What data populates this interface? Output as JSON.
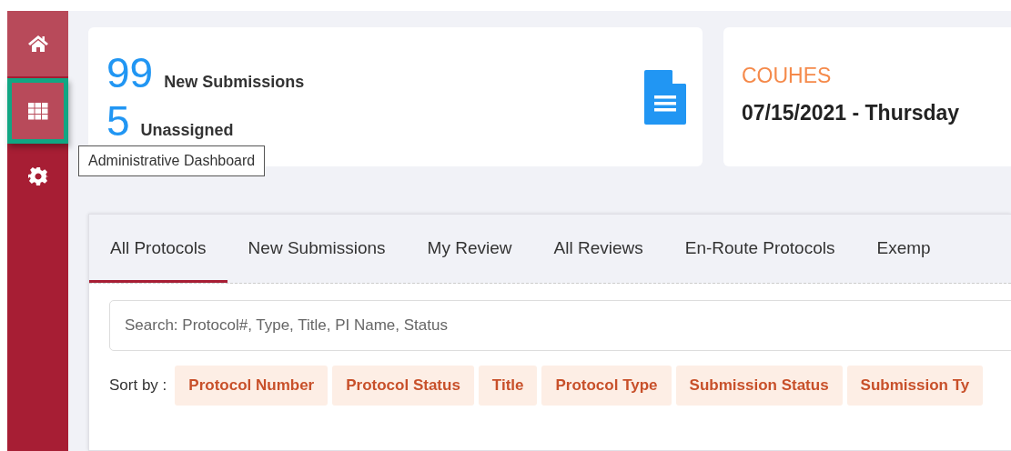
{
  "sidebar": {
    "items": [
      {
        "selected": false
      },
      {
        "selected": true
      },
      {
        "selected": false
      }
    ],
    "tooltip": "Administrative Dashboard"
  },
  "stats_card": {
    "stats": [
      {
        "count": "99",
        "label": "New Submissions"
      },
      {
        "count": "5",
        "label": "Unassigned"
      }
    ]
  },
  "info_card": {
    "title": "COUHES",
    "date": "07/15/2021 - Thursday"
  },
  "tabs": [
    {
      "label": "All Protocols",
      "selected": true
    },
    {
      "label": "New Submissions",
      "selected": false
    },
    {
      "label": "My Review",
      "selected": false
    },
    {
      "label": "All Reviews",
      "selected": false
    },
    {
      "label": "En-Route Protocols",
      "selected": false
    },
    {
      "label": "Exemp",
      "selected": false
    }
  ],
  "search": {
    "placeholder": "Search: Protocol#, Type, Title, PI Name, Status"
  },
  "sort": {
    "label": "Sort by :",
    "options": [
      "Protocol Number",
      "Protocol Status",
      "Title",
      "Protocol Type",
      "Submission Status",
      "Submission Ty"
    ]
  }
}
